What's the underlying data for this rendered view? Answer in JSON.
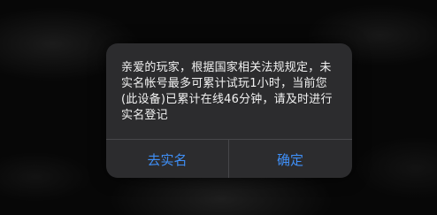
{
  "dialog": {
    "message": "亲爱的玩家，根据国家相关法规规定，未实名帐号最多可累计试玩1小时，当前您(此设备)已累计在线46分钟，请及时进行实名登记",
    "buttons": {
      "left_label": "去实名",
      "right_label": "确定"
    }
  },
  "colors": {
    "dialog_bg": "#2c2c2e",
    "text": "#f2f2f2",
    "accent": "#3f8ff7",
    "divider": "#47474a"
  }
}
